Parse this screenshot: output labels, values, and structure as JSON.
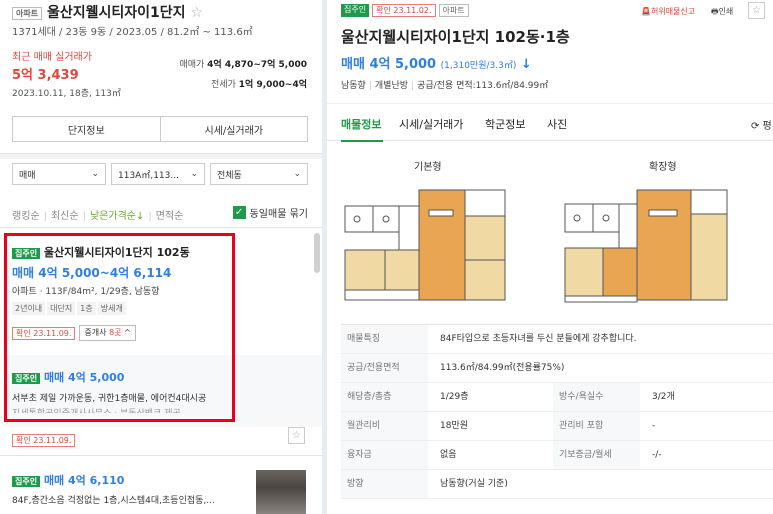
{
  "left": {
    "type_tag": "아파트",
    "title": "울산지웰시티자이1단지",
    "star": "☆",
    "subtitle": "1371세대 / 23동 9동 / 2023.05 / 81.2㎡ ~ 113.6㎡",
    "recent_label": "최근 매매 실거래가",
    "recent_price": "5억 3,439",
    "recent_date": "2023.10.11, 18층, 113㎡",
    "sale_label": "매매가",
    "sale_value": "4억 4,870~7억 5,000",
    "jeonse_label": "전세가",
    "jeonse_value": "1억 9,000~4억",
    "btn_complex": "단지정보",
    "btn_price": "시세/실거래가",
    "filter_deal": "매매",
    "filter_area": "113A㎡,113...",
    "filter_dong": "전체동",
    "sort_rank": "랭킹순",
    "sort_new": "최신순",
    "sort_low": "낮은가격순↓",
    "sort_area": "면적순",
    "dup_label": "동일매물 묶기",
    "item1": {
      "tag": "집주인",
      "title": "울산지웰시티자이1단지 102동",
      "price": "매매 4억 5,000~4억 6,114",
      "desc": "아파트 · 113F/84m², 1/29층, 남동향",
      "tags": [
        "2년이내",
        "대단지",
        "1층",
        "방세개"
      ],
      "confirm": "확인 23.11.09.",
      "agent_prefix": "중개사 ",
      "agent_count": "8곳",
      "agent_suffix": " ^"
    },
    "item1b": {
      "tag": "집주인",
      "price": "매매 4억 5,000",
      "desc": "서부초 제일 가까운동, 귀한1층매물, 에어컨4대시공",
      "cut": "지세통할공인중개사사무소 · 부동산뱅크 제공",
      "confirm": "확인 23.11.09.",
      "star": "☆"
    },
    "item2": {
      "tag": "집주인",
      "price": "매매 4억 6,110",
      "desc": "84F,층간소음 걱정없는 1층,시스템4대,초등인접동,..."
    }
  },
  "right": {
    "tag_owner": "집주인",
    "tag_confirm": "확인 23.11.02.",
    "tag_type": "아파트",
    "report": "허위매물신고",
    "print": "인쇄",
    "star": "☆",
    "title": "울산지웰시티자이1단지 102동·1층",
    "price": "매매 4억 5,000",
    "price_per": "(1,310만원/3.3㎡)",
    "price_arrow": "↓",
    "info_dir": "남동향",
    "info_heat": "개별난방",
    "info_area": "공급/전용 면적:113.6㎡/84.99㎡",
    "tabs": [
      "매물정보",
      "시세/실거래가",
      "학군정보",
      "사진"
    ],
    "refresh": "⟳ 평",
    "plan_basic": "기본형",
    "plan_ext": "확장형",
    "table": [
      {
        "k": "매물특징",
        "v": "84F타입으로 초등자녀를 두신 분들에게 강추합니다.",
        "k2": "",
        "v2": ""
      },
      {
        "k": "공급/전용면적",
        "v": "113.6㎡/84.99㎡(전용률75%)",
        "k2": "",
        "v2": ""
      },
      {
        "k": "해당층/총층",
        "v": "1/29층",
        "k2": "방수/욕실수",
        "v2": "3/2개"
      },
      {
        "k": "월관리비",
        "v": "18만원",
        "k2": "관리비 포함",
        "v2": "-"
      },
      {
        "k": "융자금",
        "v": "없음",
        "k2": "기보증금/월세",
        "v2": "-/-"
      },
      {
        "k": "방향",
        "v": "남동향(거실 기준)",
        "k2": "",
        "v2": ""
      }
    ]
  },
  "colors": {
    "accent_green": "#1e9a4a",
    "price_blue": "#2f7fe0",
    "alert_red": "#e0463d",
    "highlight_red": "#e8001c"
  }
}
